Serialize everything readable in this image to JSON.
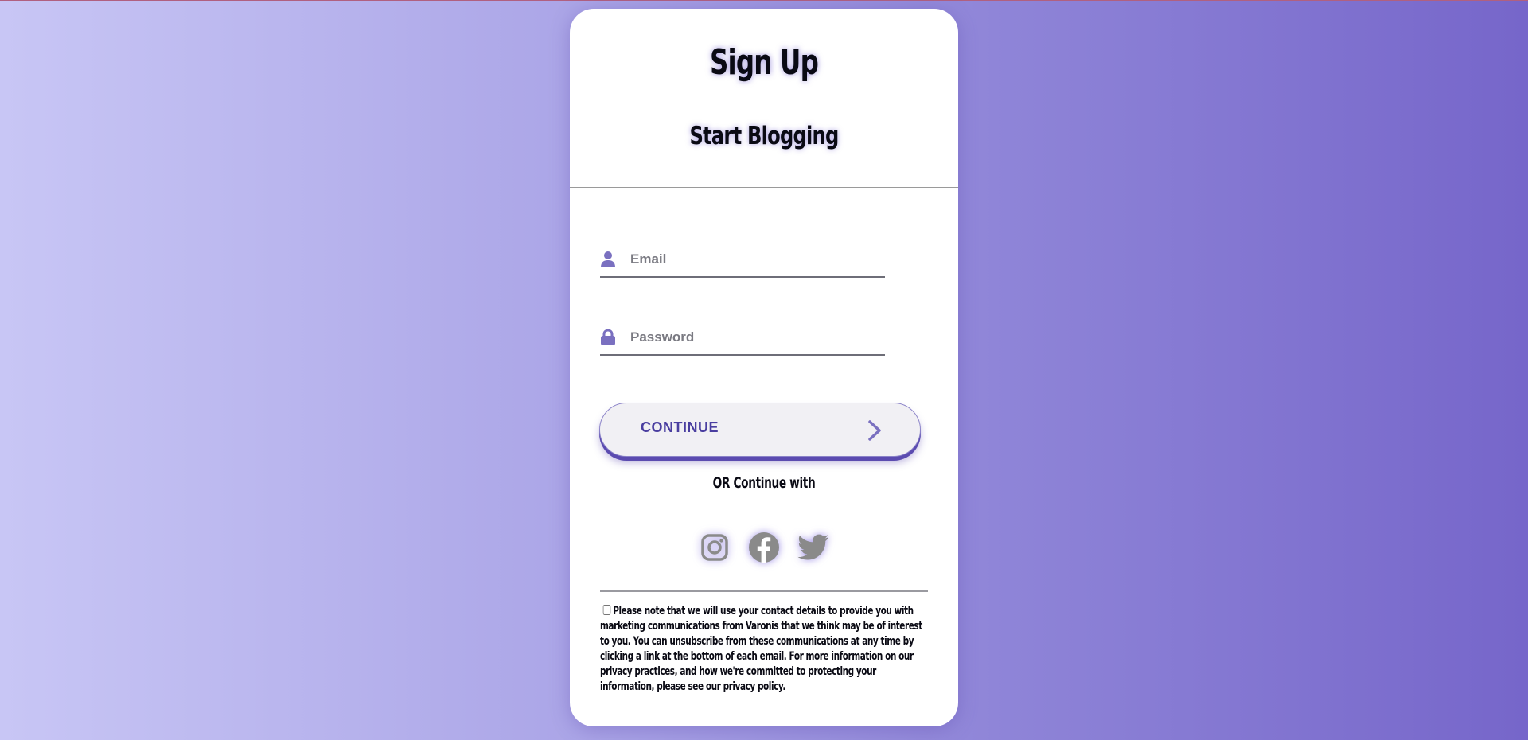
{
  "header": {
    "title": "Sign Up",
    "subtitle": "Start Blogging"
  },
  "form": {
    "email": {
      "placeholder": "Email",
      "value": "",
      "icon": "user-icon"
    },
    "password": {
      "placeholder": "Password",
      "value": "",
      "icon": "lock-icon"
    },
    "continue_label": "CONTINUE",
    "or_text": "OR Continue with"
  },
  "socials": [
    {
      "name": "instagram",
      "icon": "instagram-icon"
    },
    {
      "name": "facebook",
      "icon": "facebook-icon"
    },
    {
      "name": "twitter",
      "icon": "twitter-icon"
    }
  ],
  "consent": {
    "checked": false,
    "text": "Please note that we will use your contact details to provide you with marketing communications from Varonis that we think may be of interest to you. You can unsubscribe from these communications at any time by clicking a link at the bottom of each email. For more information on our privacy practices, and how we're committed to protecting your information, please see our privacy policy."
  },
  "colors": {
    "accent": "#5b4bb0",
    "icon": "#7a70c0",
    "social_icon": "#8a8a8a"
  }
}
